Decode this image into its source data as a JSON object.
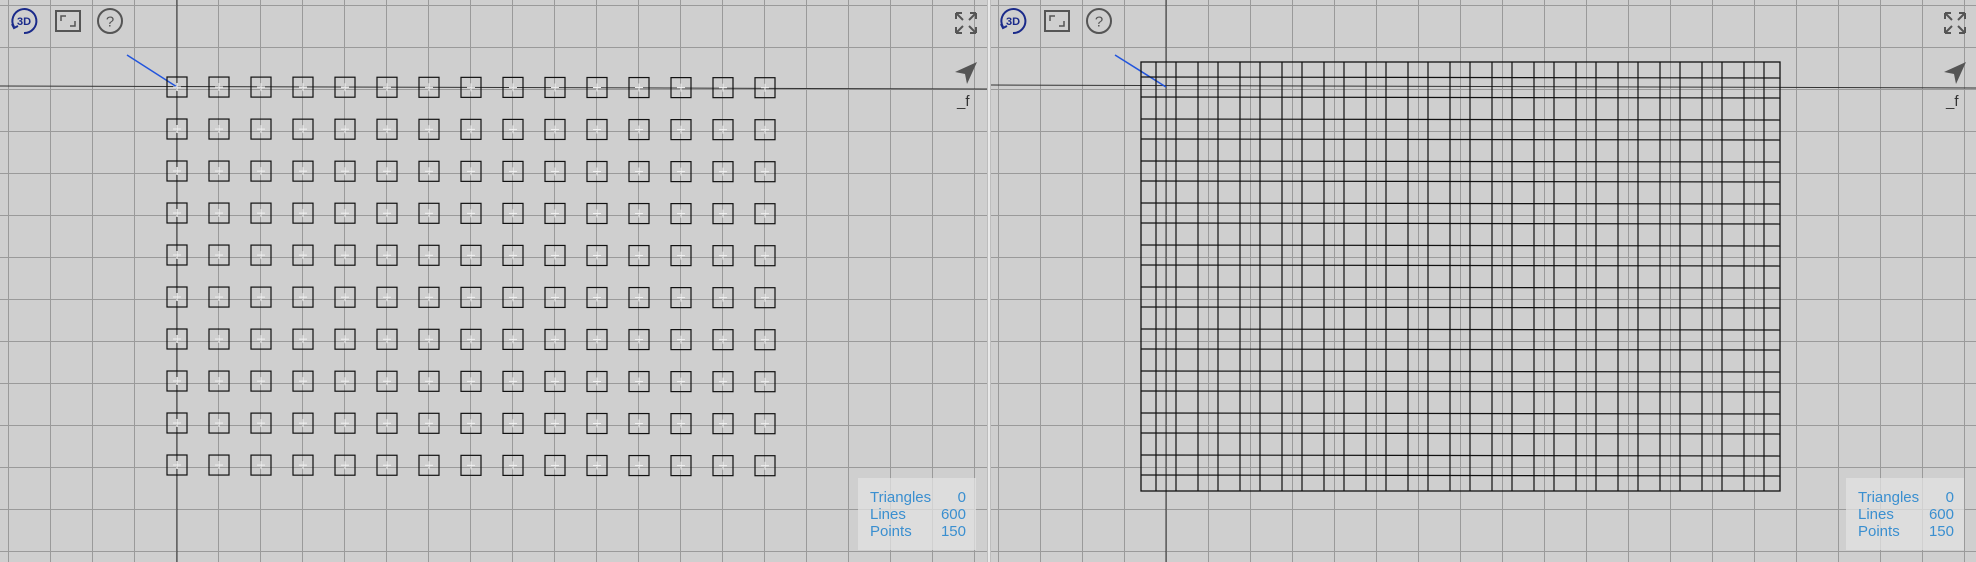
{
  "viewports": [
    {
      "id": "left",
      "toolbar": {
        "mode_3d_label": "3D",
        "f_label": "_f"
      },
      "stats": [
        {
          "label": "Triangles",
          "value": "0"
        },
        {
          "label": "Lines",
          "value": "600"
        },
        {
          "label": "Points",
          "value": "150"
        }
      ],
      "scene": {
        "cols": 15,
        "rows": 10
      }
    },
    {
      "id": "right",
      "toolbar": {
        "mode_3d_label": "3D",
        "f_label": "_f"
      },
      "stats": [
        {
          "label": "Triangles",
          "value": "0"
        },
        {
          "label": "Lines",
          "value": "600"
        },
        {
          "label": "Points",
          "value": "150"
        }
      ],
      "scene": {
        "cols": 15,
        "rows": 10
      }
    }
  ],
  "colors": {
    "axis_line": "#2255dd",
    "icon": "#555555",
    "stats_text": "#3a8fd0",
    "grid": "#9a9a9a",
    "wire": "#111111"
  }
}
